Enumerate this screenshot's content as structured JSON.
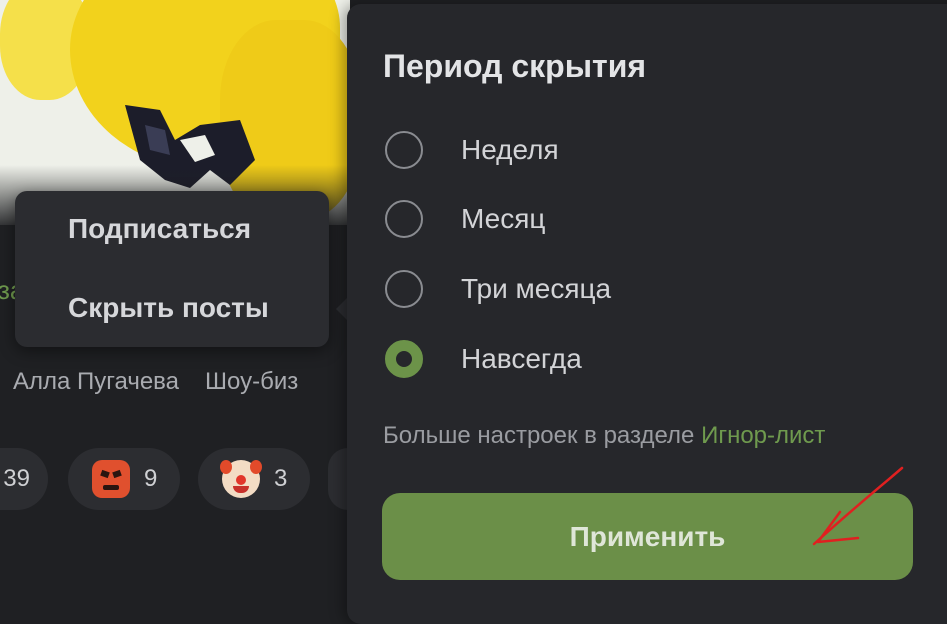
{
  "background": {
    "partial_link_text": "за",
    "tags": [
      "Алла Пугачева",
      "Шоу-биз"
    ],
    "reactions": [
      {
        "icon": "partial-hidden",
        "count": "39"
      },
      {
        "icon": "angry-face-icon",
        "count": "9"
      },
      {
        "icon": "clown-face-icon",
        "count": "3"
      }
    ]
  },
  "context_menu": {
    "items": [
      {
        "label": "Подписаться"
      },
      {
        "label": "Скрыть посты"
      }
    ]
  },
  "hide_panel": {
    "title": "Период скрытия",
    "options": [
      {
        "label": "Неделя",
        "selected": false
      },
      {
        "label": "Месяц",
        "selected": false
      },
      {
        "label": "Три месяца",
        "selected": false
      },
      {
        "label": "Навсегда",
        "selected": true
      }
    ],
    "more_text": "Больше настроек в разделе",
    "more_link": "Игнор-лист",
    "apply_label": "Применить"
  },
  "colors": {
    "accent": "#6b8f48",
    "link": "#6f9a4e",
    "panel_bg": "#26272b",
    "annotation": "#e02020"
  }
}
